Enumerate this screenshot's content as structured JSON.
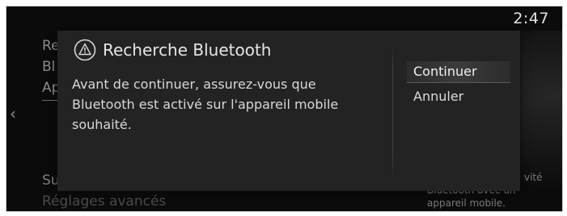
{
  "status": {
    "clock": "2:47"
  },
  "background": {
    "back_arrow": "‹",
    "menu_rows": [
      "Re",
      "Bl",
      "Ap"
    ],
    "bottom_rows": [
      "Su",
      "Réglages avancés"
    ],
    "note_lines": [
      "vité",
      "Bluetooth avec un",
      "appareil mobile."
    ]
  },
  "dialog": {
    "icon": "warning-icon",
    "title": "Recherche Bluetooth",
    "message_lines": [
      "Avant de continuer, assurez-vous que",
      "Bluetooth est activé sur l'appareil mobile",
      "souhaité."
    ],
    "actions": [
      {
        "label": "Continuer",
        "selected": true
      },
      {
        "label": "Annuler",
        "selected": false
      }
    ]
  },
  "colors": {
    "screen_bg": "#0b0b0b",
    "dialog_bg": "#232323",
    "text": "#d8d8d8"
  }
}
